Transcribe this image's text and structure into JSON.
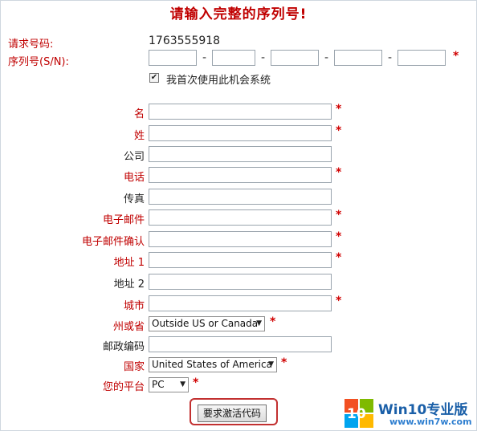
{
  "page": {
    "title": "请输入完整的序列号!"
  },
  "request": {
    "label": "请求号码:",
    "value": "1763555918"
  },
  "serial": {
    "label": "序列号(S/N):",
    "dash": "-",
    "required_mark": "*"
  },
  "first_use": {
    "checked": true,
    "check_mark": "✔",
    "label": "我首次使用此机会系统"
  },
  "form": {
    "first_name": "名",
    "last_name": "姓",
    "company": "公司",
    "phone": "电话",
    "fax": "传真",
    "email": "电子邮件",
    "email_confirm": "电子邮件确认",
    "address1": "地址 1",
    "address2": "地址 2",
    "city": "城市",
    "state": "州或省",
    "state_value": "Outside US or Canada",
    "postal": "邮政编码",
    "country": "国家",
    "country_value": "United States of America",
    "platform": "您的平台",
    "platform_value": "PC",
    "required_mark": "*"
  },
  "submit": {
    "label": "要求激活代码"
  },
  "watermark": {
    "number": "10",
    "title": "Win10专业版",
    "url": "www.win7w.com"
  },
  "colors": {
    "accent_red": "#c00000",
    "required_star": "#d00000",
    "watermark_blue": "#1a5fa8"
  }
}
